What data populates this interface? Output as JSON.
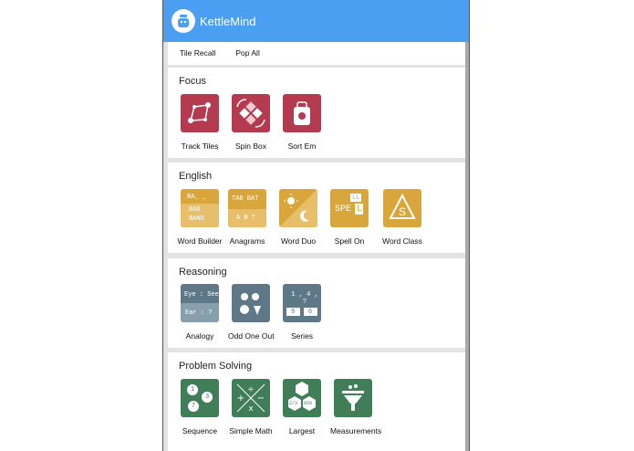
{
  "app": {
    "title": "KettleMind",
    "logo_icon": "kettle-icon"
  },
  "top_row": {
    "items": [
      "Tile Recall",
      "Pop All"
    ]
  },
  "sections": {
    "focus": {
      "title": "Focus",
      "tiles": [
        "Track Tiles",
        "Spin Box",
        "Sort Em"
      ]
    },
    "english": {
      "title": "English",
      "tiles": [
        "Word Builder",
        "Anagrams",
        "Word Duo",
        "Spell On",
        "Word Class"
      ],
      "word_builder": {
        "line1": "BA_ _",
        "line2": "BAG",
        "line3": "BAND"
      },
      "anagrams": {
        "top": "TAB BAT",
        "bottom": "A B T"
      },
      "spell_on": {
        "top": "LL",
        "main": "SPE",
        "tail": "L"
      }
    },
    "reasoning": {
      "title": "Reasoning",
      "tiles": [
        "Analogy",
        "Odd One Out",
        "Series"
      ],
      "analogy": {
        "top": "Eye : See",
        "bottom": "Ear : ?"
      },
      "series": {
        "top": "1 , 4 , ?",
        "a": "9",
        "b": "6"
      }
    },
    "problem_solving": {
      "title": "Problem Solving",
      "tiles": [
        "Sequence",
        "Simple Math",
        "Largest",
        "Measurements"
      ],
      "sequence": {
        "a": "1",
        "b": "3",
        "c": "7"
      },
      "largest": {
        "a": "2/3",
        "b": "85%"
      }
    }
  },
  "colors": {
    "appbar": "#4a9ff2",
    "focus": "#b43a4f",
    "english": "#d9a63c",
    "reasoning": "#5f7888",
    "problem_solving": "#3f7e56"
  }
}
